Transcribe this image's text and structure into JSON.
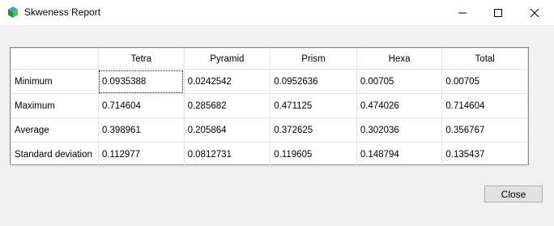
{
  "window": {
    "title": "Skweness Report"
  },
  "table": {
    "columns": [
      "Tetra",
      "Pyramid",
      "Prism",
      "Hexa",
      "Total"
    ],
    "rows": [
      {
        "label": "Minimum",
        "values": [
          "0.0935388",
          "0.0242542",
          "0.0952636",
          "0.00705",
          "0.00705"
        ]
      },
      {
        "label": "Maximum",
        "values": [
          "0.714604",
          "0.285682",
          "0.471125",
          "0.474026",
          "0.714604"
        ]
      },
      {
        "label": "Average",
        "values": [
          "0.398961",
          "0.205864",
          "0.372625",
          "0.302036",
          "0.356767"
        ]
      },
      {
        "label": "Standard deviation",
        "values": [
          "0.112977",
          "0.0812731",
          "0.119605",
          "0.148794",
          "0.135437"
        ]
      }
    ]
  },
  "buttons": {
    "close_label": "Close"
  },
  "icons": {
    "app": "app-cube-icon",
    "minimize": "minimize-icon",
    "maximize": "maximize-icon",
    "close": "close-icon"
  }
}
